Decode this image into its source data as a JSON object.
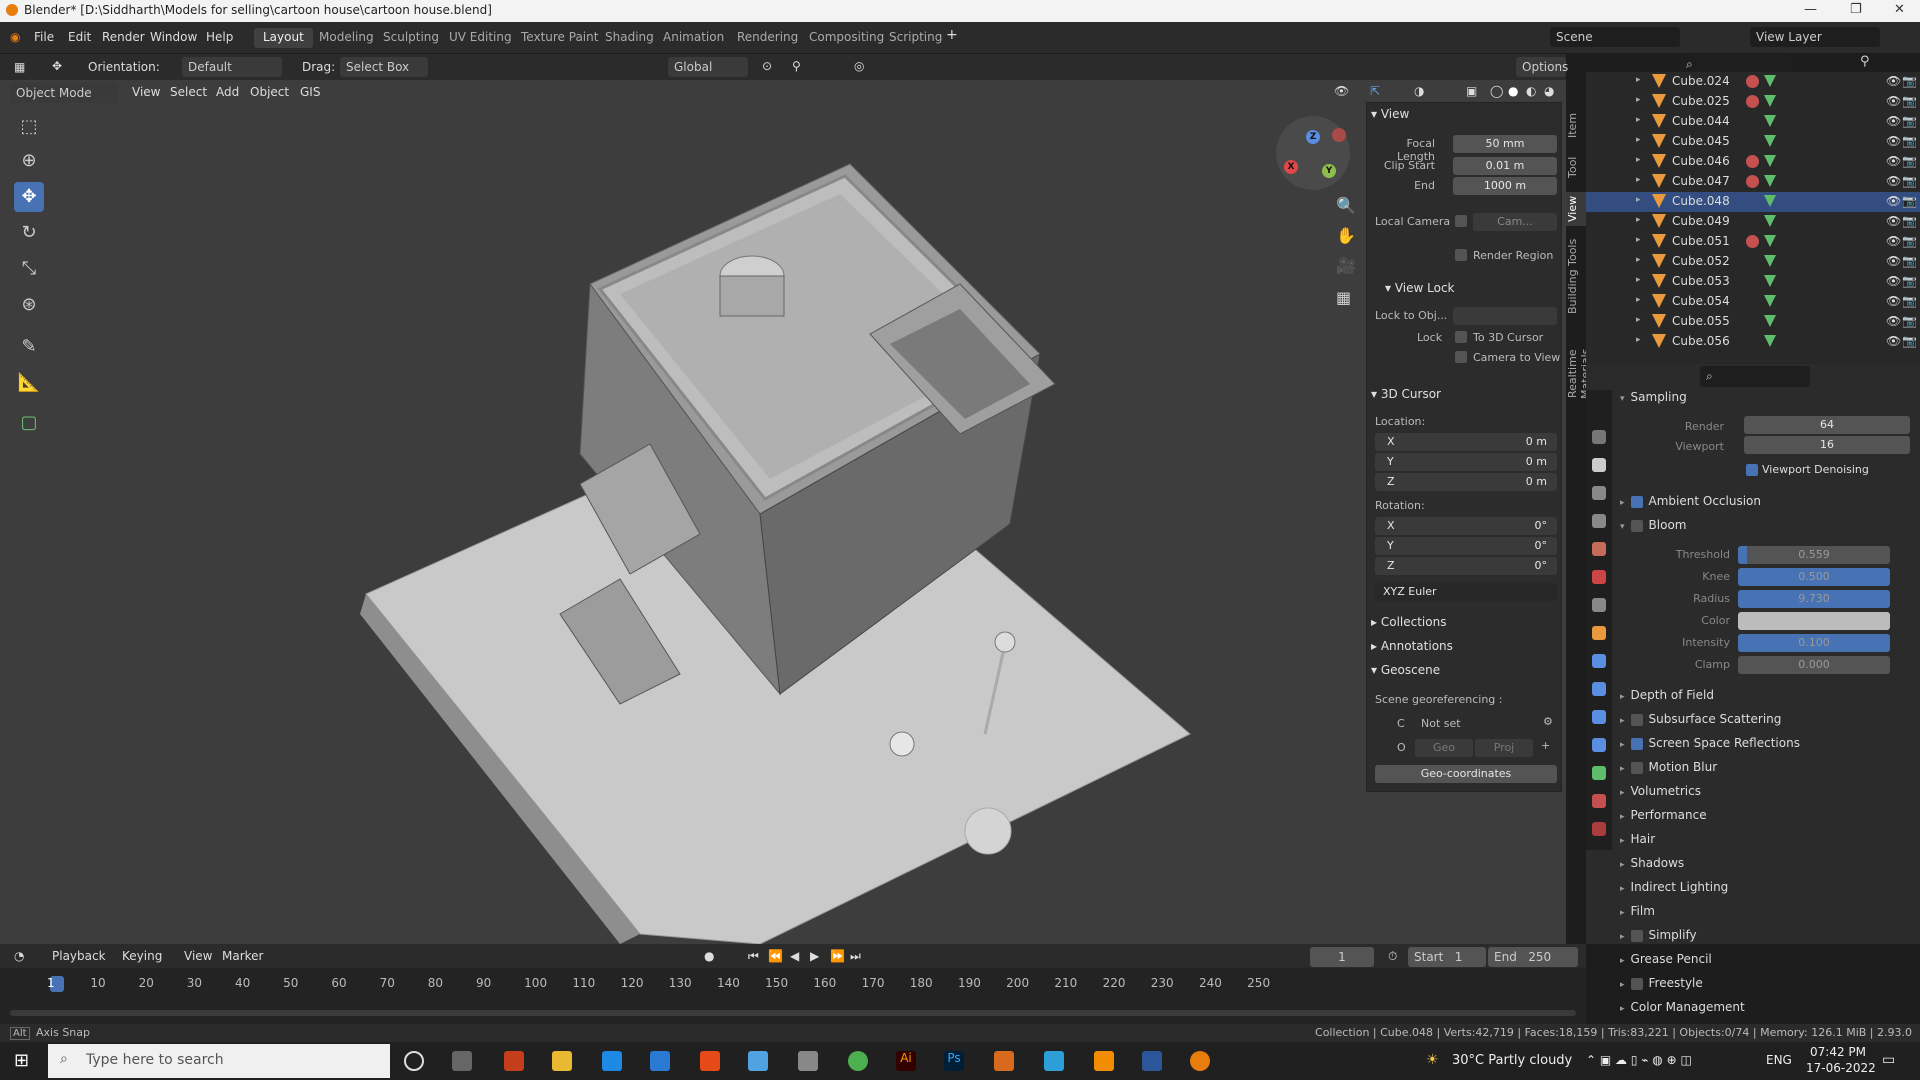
{
  "window": {
    "title": "Blender* [D:\\Siddharth\\Models for selling\\cartoon house\\cartoon house.blend]"
  },
  "menu": [
    "File",
    "Edit",
    "Render",
    "Window",
    "Help"
  ],
  "workspaces": [
    "Layout",
    "Modeling",
    "Sculpting",
    "UV Editing",
    "Texture Paint",
    "Shading",
    "Animation",
    "Rendering",
    "Compositing",
    "Scripting"
  ],
  "scene": {
    "name": "Scene",
    "view_layer": "View Layer"
  },
  "header": {
    "orientation_label": "Orientation:",
    "orientation_value": "Default",
    "drag_label": "Drag:",
    "drag_value": "Select Box",
    "transform": "Global",
    "options": "Options"
  },
  "viewport_header": {
    "mode": "Object Mode",
    "menus": [
      "View",
      "Select",
      "Add",
      "Object",
      "GIS"
    ]
  },
  "npanel": {
    "view_title": "View",
    "focal_length_label": "Focal Length",
    "focal_length": "50 mm",
    "clip_start_label": "Clip Start",
    "clip_start": "0.01 m",
    "end_label": "End",
    "end": "1000 m",
    "local_camera_label": "Local Camera",
    "local_camera_value": "Cam...",
    "render_region": "Render Region",
    "view_lock_title": "View Lock",
    "lock_to_obj_label": "Lock to Obj...",
    "lock_label": "Lock",
    "to_3d_cursor": "To 3D Cursor",
    "camera_to_view": "Camera to View",
    "cursor_title": "3D Cursor",
    "location_label": "Location:",
    "loc": [
      {
        "axis": "X",
        "val": "0 m"
      },
      {
        "axis": "Y",
        "val": "0 m"
      },
      {
        "axis": "Z",
        "val": "0 m"
      }
    ],
    "rotation_label": "Rotation:",
    "rot": [
      {
        "axis": "X",
        "val": "0°"
      },
      {
        "axis": "Y",
        "val": "0°"
      },
      {
        "axis": "Z",
        "val": "0°"
      }
    ],
    "rot_mode": "XYZ Euler",
    "collections": "Collections",
    "annotations": "Annotations",
    "geoscene": "Geoscene",
    "georef_label": "Scene georeferencing :",
    "crs_c": "C",
    "not_set": "Not set",
    "crs_o": "O",
    "geo": "Geo",
    "proj": "Proj",
    "geo_coords": "Geo-coordinates"
  },
  "side_tabs": [
    "Item",
    "Tool",
    "View",
    "Building Tools",
    "Realtime Materials"
  ],
  "outliner": [
    {
      "name": "Cube.024",
      "mat": true
    },
    {
      "name": "Cube.025",
      "mat": true
    },
    {
      "name": "Cube.044",
      "mat": false
    },
    {
      "name": "Cube.045",
      "mat": false
    },
    {
      "name": "Cube.046",
      "mat": true
    },
    {
      "name": "Cube.047",
      "mat": true
    },
    {
      "name": "Cube.048",
      "mat": false
    },
    {
      "name": "Cube.049",
      "mat": false
    },
    {
      "name": "Cube.051",
      "mat": true
    },
    {
      "name": "Cube.052",
      "mat": false
    },
    {
      "name": "Cube.053",
      "mat": false
    },
    {
      "name": "Cube.054",
      "mat": false
    },
    {
      "name": "Cube.055",
      "mat": false
    },
    {
      "name": "Cube.056",
      "mat": false
    }
  ],
  "properties": {
    "sampling": "Sampling",
    "render_label": "Render",
    "render": "64",
    "viewport_label": "Viewport",
    "viewport": "16",
    "viewport_denoising": "Viewport Denoising",
    "ambient_occlusion": "Ambient Occlusion",
    "bloom": "Bloom",
    "bloom_params": [
      {
        "label": "Threshold",
        "value": "0.559"
      },
      {
        "label": "Knee",
        "value": "0.500"
      },
      {
        "label": "Radius",
        "value": "9.730"
      },
      {
        "label": "Color",
        "value": ""
      },
      {
        "label": "Intensity",
        "value": "0.100"
      },
      {
        "label": "Clamp",
        "value": "0.000"
      }
    ],
    "panels": [
      "Depth of Field",
      "Subsurface Scattering",
      "Screen Space Reflections",
      "Motion Blur",
      "Volumetrics",
      "Performance",
      "Hair",
      "Shadows",
      "Indirect Lighting",
      "Film",
      "Simplify",
      "Grease Pencil",
      "Freestyle",
      "Color Management"
    ]
  },
  "timeline": {
    "menus": [
      "Playback",
      "Keying",
      "View",
      "Marker"
    ],
    "current": "1",
    "start_label": "Start",
    "start": "1",
    "end_label": "End",
    "end": "250",
    "ticks": [
      "1",
      "10",
      "20",
      "30",
      "40",
      "50",
      "60",
      "70",
      "80",
      "90",
      "100",
      "110",
      "120",
      "130",
      "140",
      "150",
      "160",
      "170",
      "180",
      "190",
      "200",
      "210",
      "220",
      "230",
      "240",
      "250"
    ]
  },
  "status": {
    "left": "Axis Snap",
    "right": "Collection | Cube.048 | Verts:42,719 | Faces:18,159 | Tris:83,221 | Objects:0/74 | Memory: 126.1 MiB | 2.93.0"
  },
  "taskbar": {
    "search_placeholder": "Type here to search",
    "weather": "30°C  Partly cloudy",
    "lang": "ENG",
    "time": "07:42 PM",
    "date": "17-06-2022"
  }
}
